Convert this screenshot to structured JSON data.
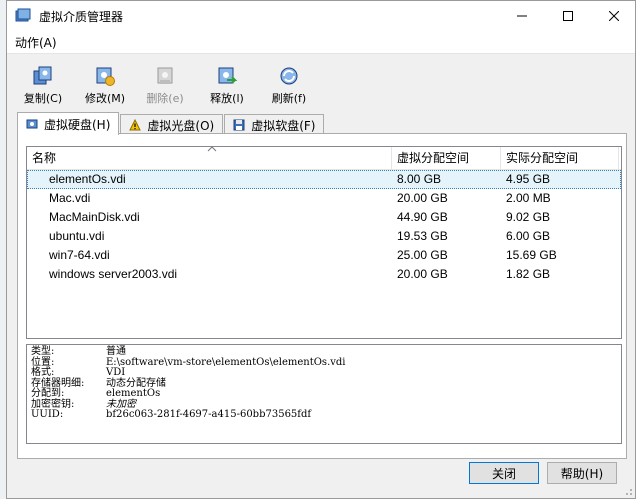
{
  "window": {
    "title": "虚拟介质管理器"
  },
  "menu": {
    "items": [
      "动作(A)"
    ]
  },
  "toolbar": {
    "copy": "复制(C)",
    "modify": "修改(M)",
    "remove": "删除(e)",
    "release": "释放(l)",
    "refresh": "刷新(f)"
  },
  "tabs": {
    "hard": "虚拟硬盘(H)",
    "optical": "虚拟光盘(O)",
    "floppy": "虚拟软盘(F)"
  },
  "table": {
    "headers": [
      "名称",
      "虚拟分配空间",
      "实际分配空间"
    ],
    "rows": [
      {
        "name": "elementOs.vdi",
        "virtual": "8.00 GB",
        "actual": "4.95 GB"
      },
      {
        "name": "Mac.vdi",
        "virtual": "20.00 GB",
        "actual": "2.00 MB"
      },
      {
        "name": "MacMainDisk.vdi",
        "virtual": "44.90 GB",
        "actual": "9.02 GB"
      },
      {
        "name": "ubuntu.vdi",
        "virtual": "19.53 GB",
        "actual": "6.00 GB"
      },
      {
        "name": "win7-64.vdi",
        "virtual": "25.00 GB",
        "actual": "15.69 GB"
      },
      {
        "name": "windows server2003.vdi",
        "virtual": "20.00 GB",
        "actual": "1.82 GB"
      }
    ]
  },
  "details": {
    "type_label": "类型:",
    "type_value": "普通",
    "location_label": "位置:",
    "location_value": "E:\\software\\vm-store\\elementOs\\elementOs.vdi",
    "format_label": "格式:",
    "format_value": "VDI",
    "storage_label": "存储器明细:",
    "storage_value": "动态分配存储",
    "attached_label": "分配到:",
    "attached_value": "elementOs",
    "encryption_label": "加密密钥:",
    "encryption_value": "未加密",
    "uuid_label": "UUID:",
    "uuid_value": "bf26c063-281f-4697-a415-60bb73565fdf"
  },
  "buttons": {
    "close": "关闭",
    "help": "帮助(H)"
  },
  "colors": {
    "selection": "#e5f3fb",
    "window_bg": "#f0f0f0",
    "accent": "#0078d7"
  }
}
